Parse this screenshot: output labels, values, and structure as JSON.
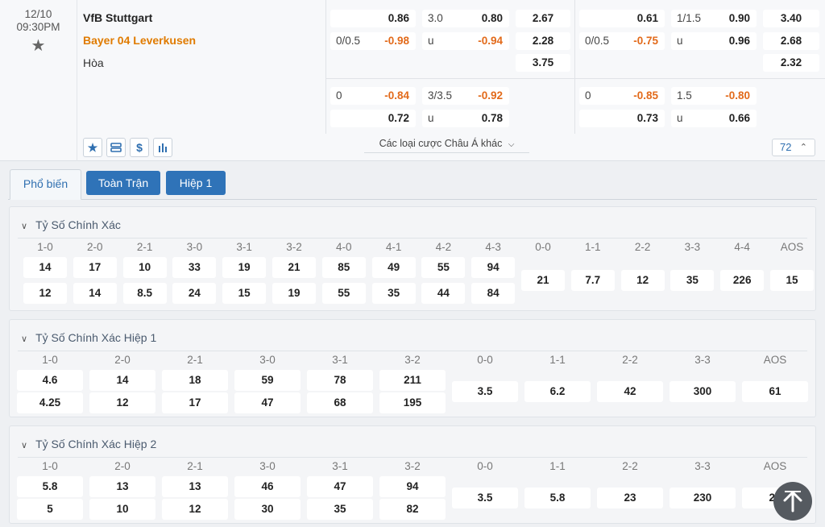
{
  "match": {
    "date": "12/10",
    "time": "09:30PM",
    "home": "VfB Stuttgart",
    "away": "Bayer 04 Leverkusen",
    "draw": "Hòa"
  },
  "odds": {
    "ft_row1": {
      "hdp_line_home": "",
      "hdp_home": "0.86",
      "ou_line": "3.0",
      "ou_over": "0.80",
      "x12_home": "2.67",
      "hdp_line_away": "0/0.5",
      "hdp_away": "-0.98",
      "ou_u": "u",
      "ou_under": "-0.94",
      "x12_away": "2.28",
      "x12_draw": "3.75"
    },
    "h1_row1": {
      "hdp_home": "0.61",
      "ou_line": "1/1.5",
      "ou_over": "0.90",
      "x12_home": "3.40",
      "hdp_line_away": "0/0.5",
      "hdp_away": "-0.75",
      "ou_u": "u",
      "ou_under": "0.96",
      "x12_away": "2.68",
      "x12_draw": "2.32"
    },
    "ft_row2": {
      "hdp_line": "0",
      "hdp_home": "-0.84",
      "ou_line": "3/3.5",
      "ou_over": "-0.92",
      "hdp_away": "0.72",
      "ou_u": "u",
      "ou_under": "0.78"
    },
    "h1_row2": {
      "hdp_line": "0",
      "hdp_home": "-0.85",
      "ou_line": "1.5",
      "ou_over": "-0.80",
      "hdp_away": "0.73",
      "ou_u": "u",
      "ou_under": "0.66"
    }
  },
  "toolbar": {
    "more_asian": "Các loại cược Châu Á khác",
    "market_count": "72",
    "icons": [
      "star-icon",
      "layers-icon",
      "dollar-icon",
      "bar-chart-icon"
    ]
  },
  "tabs": [
    {
      "label": "Phổ biến"
    },
    {
      "label": "Toàn Trận"
    },
    {
      "label": "Hiệp 1"
    }
  ],
  "panels": [
    {
      "title": "Tỷ Số Chính Xác",
      "scores": [
        "1-0",
        "2-0",
        "2-1",
        "3-0",
        "3-1",
        "3-2",
        "4-0",
        "4-1",
        "4-2",
        "4-3"
      ],
      "home": [
        "14",
        "17",
        "10",
        "33",
        "19",
        "21",
        "85",
        "49",
        "55",
        "94"
      ],
      "away": [
        "12",
        "14",
        "8.5",
        "24",
        "15",
        "19",
        "55",
        "35",
        "44",
        "84"
      ],
      "draws": [
        "0-0",
        "1-1",
        "2-2",
        "3-3",
        "4-4",
        "AOS"
      ],
      "draw_odds": [
        "21",
        "7.7",
        "12",
        "35",
        "226",
        "15"
      ]
    },
    {
      "title": "Tỷ Số Chính Xác Hiệp 1",
      "scores": [
        "1-0",
        "2-0",
        "2-1",
        "3-0",
        "3-1",
        "3-2"
      ],
      "home": [
        "4.6",
        "14",
        "18",
        "59",
        "78",
        "211"
      ],
      "away": [
        "4.25",
        "12",
        "17",
        "47",
        "68",
        "195"
      ],
      "draws": [
        "0-0",
        "1-1",
        "2-2",
        "3-3",
        "AOS"
      ],
      "draw_odds": [
        "3.5",
        "6.2",
        "42",
        "300",
        "61"
      ]
    },
    {
      "title": "Tỷ Số Chính Xác Hiệp 2",
      "scores": [
        "1-0",
        "2-0",
        "2-1",
        "3-0",
        "3-1",
        "3-2"
      ],
      "home": [
        "5.8",
        "13",
        "13",
        "46",
        "47",
        "94"
      ],
      "away": [
        "5",
        "10",
        "12",
        "30",
        "35",
        "82"
      ],
      "draws": [
        "0-0",
        "1-1",
        "2-2",
        "3-3",
        "AOS"
      ],
      "draw_odds": [
        "3.5",
        "5.8",
        "23",
        "230",
        "26"
      ]
    }
  ],
  "colors": {
    "accent": "#2f73b8",
    "negative": "#e26a1a",
    "away_team": "#e07b00"
  }
}
